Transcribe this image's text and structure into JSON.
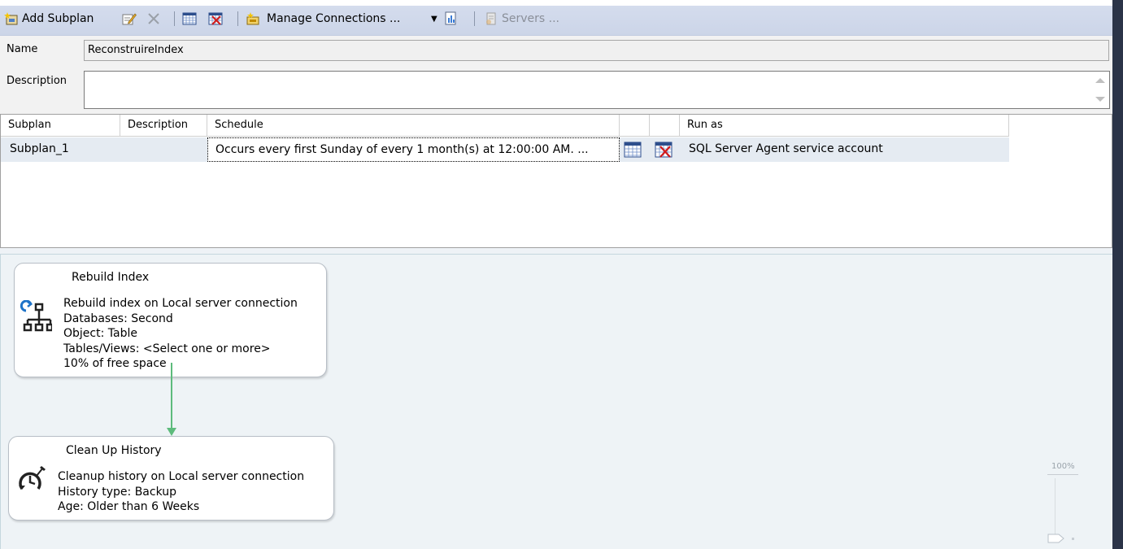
{
  "toolbar": {
    "add_subplan": "Add Subplan",
    "manage_connections": "Manage Connections ...",
    "servers": "Servers ..."
  },
  "properties": {
    "name_label": "Name",
    "name_value": "ReconstruireIndex",
    "description_label": "Description",
    "description_value": ""
  },
  "grid": {
    "headers": [
      "Subplan",
      "Description",
      "Schedule",
      "",
      "",
      "Run as"
    ],
    "rows": [
      {
        "subplan": "Subplan_1",
        "description": "",
        "schedule": "Occurs every first Sunday of every 1 month(s) at 12:00:00 AM. ...",
        "run_as": "SQL Server Agent service account"
      }
    ]
  },
  "tasks": [
    {
      "title": "Rebuild Index",
      "icon": "rebuild-index-icon",
      "lines": [
        "Rebuild index on Local server connection",
        "Databases: Second",
        "Object: Table",
        "Tables/Views: <Select one or more>",
        "10% of free space"
      ]
    },
    {
      "title": "Clean Up History",
      "icon": "cleanup-history-icon",
      "lines": [
        "Cleanup history on Local server connection",
        "History type: Backup",
        "Age: Older than 6 Weeks"
      ]
    }
  ],
  "zoom": {
    "label": "100%"
  },
  "colors": {
    "precedence_arrow": "#5dbb7c",
    "toolbar_bg": "#ccd5e8"
  }
}
